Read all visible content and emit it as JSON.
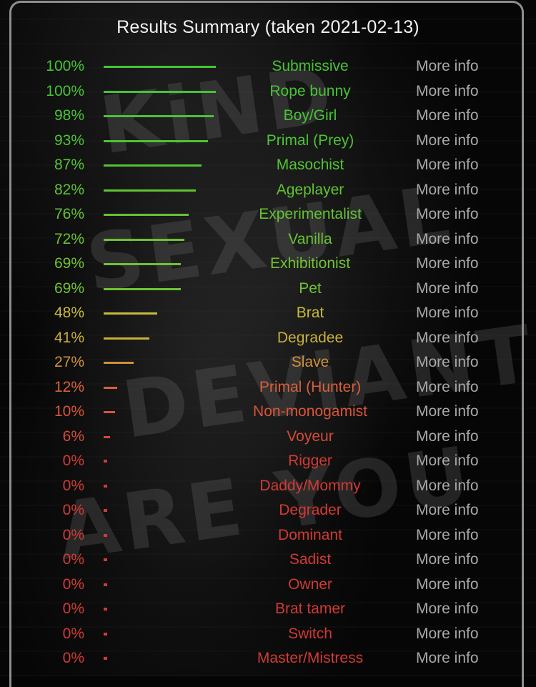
{
  "title": "Results Summary (taken 2021-02-13)",
  "more_info_label": "More info",
  "colors": {
    "green": "#4fc63a",
    "lime": "#6cc233",
    "yellow": "#c8b73a",
    "orange": "#d08a36",
    "orange_red": "#d9583a",
    "red": "#d23a34",
    "more_info": "#a8a8a8",
    "title": "#f2f2f2",
    "border": "#8e8e8e"
  },
  "results": [
    {
      "percent": 100,
      "label": "100%",
      "name": "Submissive",
      "color": "#45c436"
    },
    {
      "percent": 100,
      "label": "100%",
      "name": "Rope bunny",
      "color": "#45c436"
    },
    {
      "percent": 98,
      "label": "98%",
      "name": "Boy/Girl",
      "color": "#48c436"
    },
    {
      "percent": 93,
      "label": "93%",
      "name": "Primal (Prey)",
      "color": "#4cc435"
    },
    {
      "percent": 87,
      "label": "87%",
      "name": "Masochist",
      "color": "#52c434"
    },
    {
      "percent": 82,
      "label": "82%",
      "name": "Ageplayer",
      "color": "#5ec233"
    },
    {
      "percent": 76,
      "label": "76%",
      "name": "Experimentalist",
      "color": "#64c233"
    },
    {
      "percent": 72,
      "label": "72%",
      "name": "Vanilla",
      "color": "#6ac232"
    },
    {
      "percent": 69,
      "label": "69%",
      "name": "Exhibitionist",
      "color": "#70c232"
    },
    {
      "percent": 69,
      "label": "69%",
      "name": "Pet",
      "color": "#70c232"
    },
    {
      "percent": 48,
      "label": "48%",
      "name": "Brat",
      "color": "#c6bb3a"
    },
    {
      "percent": 41,
      "label": "41%",
      "name": "Degradee",
      "color": "#c8b03a"
    },
    {
      "percent": 27,
      "label": "27%",
      "name": "Slave",
      "color": "#d0903a"
    },
    {
      "percent": 12,
      "label": "12%",
      "name": "Primal (Hunter)",
      "color": "#d9603a"
    },
    {
      "percent": 10,
      "label": "10%",
      "name": "Non-monogamist",
      "color": "#d9553a"
    },
    {
      "percent": 6,
      "label": "6%",
      "name": "Voyeur",
      "color": "#d64a38"
    },
    {
      "percent": 0,
      "label": "0%",
      "name": "Rigger",
      "color": "#d23a34"
    },
    {
      "percent": 0,
      "label": "0%",
      "name": "Daddy/Mommy",
      "color": "#d23a34"
    },
    {
      "percent": 0,
      "label": "0%",
      "name": "Degrader",
      "color": "#d23a34"
    },
    {
      "percent": 0,
      "label": "0%",
      "name": "Dominant",
      "color": "#d23a34"
    },
    {
      "percent": 0,
      "label": "0%",
      "name": "Sadist",
      "color": "#d23a34"
    },
    {
      "percent": 0,
      "label": "0%",
      "name": "Owner",
      "color": "#d23a34"
    },
    {
      "percent": 0,
      "label": "0%",
      "name": "Brat tamer",
      "color": "#d23a34"
    },
    {
      "percent": 0,
      "label": "0%",
      "name": "Switch",
      "color": "#d23a34"
    },
    {
      "percent": 0,
      "label": "0%",
      "name": "Master/Mistress",
      "color": "#d23a34"
    }
  ]
}
